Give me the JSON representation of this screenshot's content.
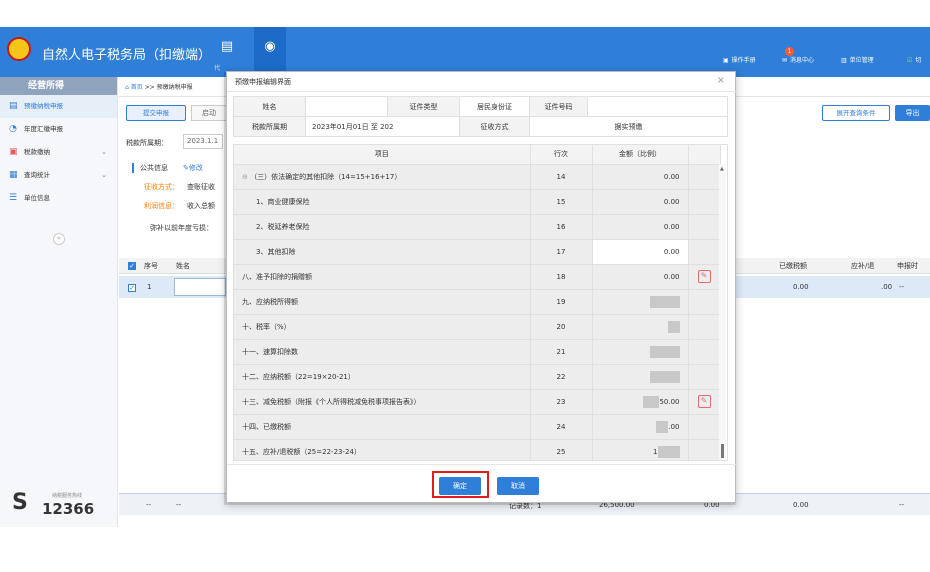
{
  "header": {
    "title": "自然人电子税务局（扣缴端）",
    "toolbar_1_label": "代",
    "toolbar_2_label": "",
    "links": [
      "操作手册",
      "消息中心",
      "单位管理",
      "切"
    ],
    "notify_badge": "1"
  },
  "sidebar": {
    "heading": "经营所得",
    "items": [
      {
        "label": "预缴纳税申报",
        "active": true
      },
      {
        "label": "年度汇缴申报",
        "active": false
      },
      {
        "label": "税款缴纳",
        "active": false
      },
      {
        "label": "查询统计",
        "active": false
      },
      {
        "label": "单位信息",
        "active": false
      }
    ],
    "collapse": "«",
    "hotline_label": "纳税服务热线",
    "hotline_number": "12366"
  },
  "main": {
    "breadcrumb_home": "首页",
    "breadcrumb_sep": ">>",
    "breadcrumb_current": "预缴纳税申报",
    "submit_button": "提交申报",
    "start_button": "启动",
    "period_label": "税款所属期：",
    "period_value": "2023.1.1",
    "expand_button": "展开查询条件",
    "export_button": "导出",
    "public_info": "公共信息",
    "modify": "修改",
    "levy_label": "征收方式：",
    "levy_value": "查账征收",
    "profit_label": "利润信息：",
    "profit_value": "收入总额",
    "loss_label": "弥补以前年度亏损：",
    "table_headers": [
      "序号",
      "姓名"
    ],
    "right_headers": [
      "已缴税额",
      "应补/退",
      "申报时"
    ],
    "row": {
      "index": "1",
      "paid": "0.00",
      "due": ".00",
      "time": "--"
    },
    "bottom": {
      "c1": "--",
      "c2": "--",
      "records": "记录数：1",
      "total": "26,500.00",
      "v1": "0.00",
      "v2": "0.00",
      "v3": "--"
    }
  },
  "modal": {
    "title": "预缴申报编辑界面",
    "close": "×",
    "info": {
      "name_key": "姓名",
      "name_val": "",
      "idtype_key": "证件类型",
      "idtype_val": "居民身份证",
      "idno_key": "证件号码",
      "idno_val": "",
      "period_key": "税款所属期",
      "period_val": "2023年01月01日 至 202",
      "levy_key": "征收方式",
      "levy_val": "据实预缴"
    },
    "columns": [
      "项目",
      "行次",
      "金额（比例）"
    ],
    "rows": [
      {
        "item": "（三）依法确定的其他扣除（14=15+16+17）",
        "line": "14",
        "amount": "0.00",
        "indent": false,
        "collapse": true,
        "editable": false,
        "white": false
      },
      {
        "item": "1、商业健康保险",
        "line": "15",
        "amount": "0.00",
        "indent": true,
        "editable": false,
        "white": false
      },
      {
        "item": "2、税延养老保险",
        "line": "16",
        "amount": "0.00",
        "indent": true,
        "editable": false,
        "white": false
      },
      {
        "item": "3、其他扣除",
        "line": "17",
        "amount": "0.00",
        "indent": true,
        "editable": false,
        "white": true
      },
      {
        "item": "八、准予扣除的捐赠额",
        "line": "18",
        "amount": "0.00",
        "indent": false,
        "editable": true,
        "white": false
      },
      {
        "item": "九、应纳税所得额",
        "line": "19",
        "amount": "",
        "indent": false,
        "editable": false,
        "white": false
      },
      {
        "item": "十、税率（%）",
        "line": "20",
        "amount": "",
        "indent": false,
        "editable": false,
        "white": false
      },
      {
        "item": "十一、速算扣除数",
        "line": "21",
        "amount": "",
        "indent": false,
        "editable": false,
        "white": false
      },
      {
        "item": "十二、应纳税额（22=19×20-21）",
        "line": "22",
        "amount": "",
        "indent": false,
        "editable": false,
        "white": false
      },
      {
        "item": "十三、减免税额（附报《个人所得税减免税事项报告表》）",
        "line": "23",
        "amount": "50.00",
        "indent": false,
        "editable": true,
        "white": false
      },
      {
        "item": "十四、已缴税额",
        "line": "24",
        "amount": ".00",
        "indent": false,
        "editable": false,
        "white": false
      },
      {
        "item": "十五、应补/退税额（25=22-23-24）",
        "line": "25",
        "amount": "1",
        "indent": false,
        "editable": false,
        "white": false
      }
    ],
    "confirm": "确定",
    "cancel": "取消"
  },
  "colors": {
    "brand": "#2f7ed8",
    "highlight": "#e21b1b",
    "accent": "#ff7a00"
  }
}
